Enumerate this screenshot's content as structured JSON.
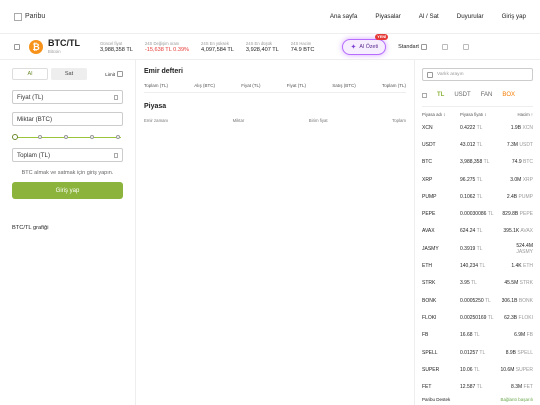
{
  "logo": {
    "alt": "Paribu"
  },
  "nav": {
    "items": [
      "Ana sayfa",
      "Piyasalar",
      "Al / Sat",
      "Duyurular",
      "Giriş yap"
    ]
  },
  "ticker": {
    "pair": "BTC/TL",
    "coin": "Bitcoin",
    "coin_symbol": "₿",
    "stats": [
      {
        "label": "Güncel fiyat",
        "value": "3,988,358 TL"
      },
      {
        "label": "24S Değişim oranı",
        "value": "-15,638 TL  0.39%",
        "neg": true
      },
      {
        "label": "24S En yüksek",
        "value": "4,097,584 TL"
      },
      {
        "label": "24S En düşük",
        "value": "3,928,407 TL"
      },
      {
        "label": "24S Hacim",
        "value": "74.9 BTC"
      }
    ],
    "ai_label": "AI Özeti",
    "ai_badge": "YENİ",
    "view_label": "Standart"
  },
  "order": {
    "buy": "Al",
    "sell": "Sat",
    "limit": "Limit",
    "price": "Fiyat (TL)",
    "amount": "Miktar (BTC)",
    "total": "Toplam (TL)",
    "hint": "BTC almak ve satmak için giriş yapın.",
    "login": "Giriş yap",
    "chart": "BTC/TL grafiği"
  },
  "orderbook": {
    "title": "Emir defteri",
    "cols": [
      "Toplam (TL)",
      "Alış (BTC)",
      "Fiyat (TL)",
      "Fiyat (TL)",
      "Satış (BTC)",
      "Toplam (TL)"
    ]
  },
  "market_trades": {
    "title": "Piyasa",
    "cols": [
      "Emir zamanı",
      "Miktar",
      "Birim fiyat",
      "Toplam"
    ]
  },
  "markets": {
    "search_placeholder": "Varlık arayın",
    "tabs": [
      "TL",
      "USDT",
      "FAN",
      "BOX"
    ],
    "cols": [
      "Piyasa adı ↕",
      "Piyasa fiyatı ↕",
      "Hacim ↑"
    ],
    "rows": [
      {
        "name": "XCN",
        "price": "0.4222",
        "cur": "TL",
        "vol": "1.9B",
        "sym": "XCN"
      },
      {
        "name": "USDT",
        "price": "43.012",
        "cur": "TL",
        "vol": "7.3M",
        "sym": "USDT"
      },
      {
        "name": "BTC",
        "price": "3,988,358",
        "cur": "TL",
        "vol": "74.9",
        "sym": "BTC"
      },
      {
        "name": "XRP",
        "price": "96.275",
        "cur": "TL",
        "vol": "3.0M",
        "sym": "XRP"
      },
      {
        "name": "PUMP",
        "price": "0.1062",
        "cur": "TL",
        "vol": "2.4B",
        "sym": "PUMP"
      },
      {
        "name": "PEPE",
        "price": "0.00030086",
        "cur": "TL",
        "vol": "829.8B",
        "sym": "PEPE"
      },
      {
        "name": "AVAX",
        "price": "624.24",
        "cur": "TL",
        "vol": "395.1K",
        "sym": "AVAX"
      },
      {
        "name": "JASMY",
        "price": "0.3919",
        "cur": "TL",
        "vol": "524.4M",
        "sym": "JASMY"
      },
      {
        "name": "ETH",
        "price": "140,234",
        "cur": "TL",
        "vol": "1.4K",
        "sym": "ETH"
      },
      {
        "name": "STRK",
        "price": "3.95",
        "cur": "TL",
        "vol": "45.5M",
        "sym": "STRK"
      },
      {
        "name": "BONK",
        "price": "0.0005250",
        "cur": "TL",
        "vol": "306.1B",
        "sym": "BONK"
      },
      {
        "name": "FLOKI",
        "price": "0.00250169",
        "cur": "TL",
        "vol": "62.3B",
        "sym": "FLOKI"
      },
      {
        "name": "FB",
        "price": "16.68",
        "cur": "TL",
        "vol": "6.9M",
        "sym": "FB"
      },
      {
        "name": "SPELL",
        "price": "0.01257",
        "cur": "TL",
        "vol": "8.9B",
        "sym": "SPELL"
      },
      {
        "name": "SUPER",
        "price": "10.06",
        "cur": "TL",
        "vol": "10.6M",
        "sym": "SUPER"
      },
      {
        "name": "FET",
        "price": "12.587",
        "cur": "TL",
        "vol": "8.3M",
        "sym": "FET"
      }
    ],
    "support": "Paribu Destek",
    "connection": "Bağlantı başarılı"
  }
}
